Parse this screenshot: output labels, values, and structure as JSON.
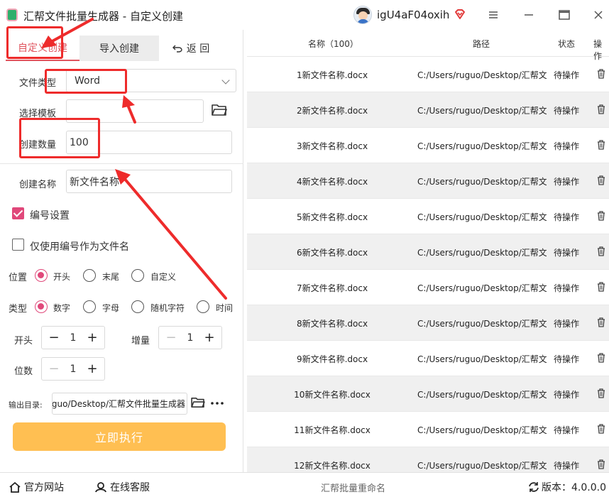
{
  "window": {
    "title": "汇帮文件批量生成器 - 自定义创建",
    "username": "igU4aF04oxih",
    "controls": [
      "menu",
      "minimize",
      "maximize",
      "close"
    ]
  },
  "tabs": {
    "custom": "自定义创建",
    "import": "导入创建",
    "back": "返 回",
    "back_icon": "undo-icon"
  },
  "form": {
    "file_type_label": "文件类型",
    "file_type_value": "Word",
    "template_label": "选择模板",
    "template_value": "",
    "count_label": "创建数量",
    "count_value": "100",
    "name_label": "创建名称",
    "name_value": "新文件名称",
    "numbering_label": "编号设置",
    "numbering_checked": true,
    "only_number_label": "仅使用编号作为文件名",
    "only_number_checked": false,
    "position_label": "位置",
    "position_options": [
      "开头",
      "末尾",
      "自定义"
    ],
    "position_selected": "开头",
    "type_label": "类型",
    "type_options": [
      "数字",
      "字母",
      "随机字符",
      "时间"
    ],
    "type_selected": "数字",
    "start_label": "开头",
    "start_value": "1",
    "increment_label": "增量",
    "increment_value": "1",
    "digits_label": "位数",
    "digits_value": "1",
    "output_label": "输出目录:",
    "output_value": "guo/Desktop/汇帮文件批量生成器",
    "run_button": "立即执行"
  },
  "table": {
    "headers": {
      "name": "名称（100）",
      "path": "路径",
      "status": "状态",
      "action": "操作"
    },
    "rows": [
      {
        "name": "1新文件名称.docx",
        "path": "C:/Users/ruguo/Desktop/汇帮文",
        "status": "待操作"
      },
      {
        "name": "2新文件名称.docx",
        "path": "C:/Users/ruguo/Desktop/汇帮文",
        "status": "待操作"
      },
      {
        "name": "3新文件名称.docx",
        "path": "C:/Users/ruguo/Desktop/汇帮文",
        "status": "待操作"
      },
      {
        "name": "4新文件名称.docx",
        "path": "C:/Users/ruguo/Desktop/汇帮文",
        "status": "待操作"
      },
      {
        "name": "5新文件名称.docx",
        "path": "C:/Users/ruguo/Desktop/汇帮文",
        "status": "待操作"
      },
      {
        "name": "6新文件名称.docx",
        "path": "C:/Users/ruguo/Desktop/汇帮文",
        "status": "待操作"
      },
      {
        "name": "7新文件名称.docx",
        "path": "C:/Users/ruguo/Desktop/汇帮文",
        "status": "待操作"
      },
      {
        "name": "8新文件名称.docx",
        "path": "C:/Users/ruguo/Desktop/汇帮文",
        "status": "待操作"
      },
      {
        "name": "9新文件名称.docx",
        "path": "C:/Users/ruguo/Desktop/汇帮文",
        "status": "待操作"
      },
      {
        "name": "10新文件名称.docx",
        "path": "C:/Users/ruguo/Desktop/汇帮文",
        "status": "待操作"
      },
      {
        "name": "11新文件名称.docx",
        "path": "C:/Users/ruguo/Desktop/汇帮文",
        "status": "待操作"
      },
      {
        "name": "12新文件名称.docx",
        "path": "C:/Users/ruguo/Desktop/汇帮文",
        "status": "待操作"
      }
    ]
  },
  "footer": {
    "website": "官方网站",
    "support": "在线客服",
    "center": "汇帮批量重命名",
    "version": "版本：4.0.0.0"
  },
  "colors": {
    "accent": "#e0487a",
    "run_button": "#ffbf52",
    "annotation": "#ee2b2b"
  }
}
